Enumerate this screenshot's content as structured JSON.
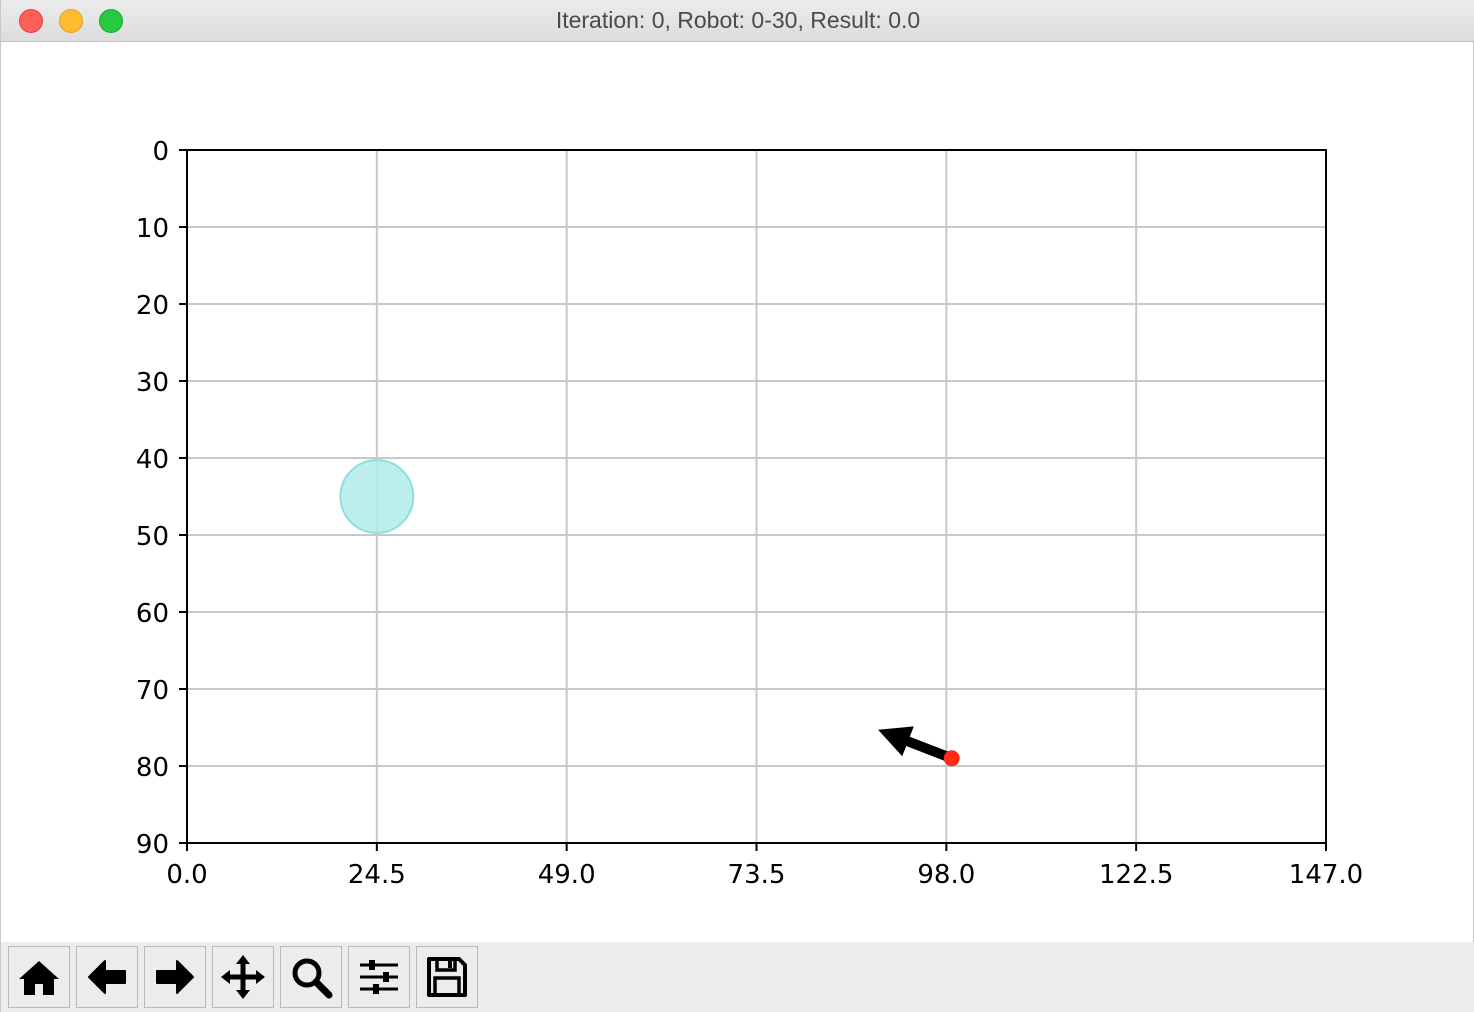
{
  "window": {
    "title": "Iteration: 0, Robot: 0-30, Result: 0.0"
  },
  "plot": {
    "x_ticks": [
      "0.0",
      "24.5",
      "49.0",
      "73.5",
      "98.0",
      "122.5",
      "147.0"
    ],
    "y_ticks": [
      "0",
      "10",
      "20",
      "30",
      "40",
      "50",
      "60",
      "70",
      "80",
      "90"
    ],
    "grid": true,
    "y_inverted": true,
    "colors": {
      "target": "#b2ebeb",
      "target_edge": "#8fdede",
      "robot": "#ff2a1a",
      "arrow": "#000000",
      "grid": "#c8c8c8"
    }
  },
  "chart_data": {
    "type": "scatter",
    "xlim": [
      0,
      147
    ],
    "ylim": [
      90,
      0
    ],
    "title": "",
    "xlabel": "",
    "ylabel": "",
    "target": {
      "x": 24.5,
      "y": 45,
      "radius": 4.7
    },
    "robot": {
      "x": 98.7,
      "y": 79
    },
    "heading": {
      "dx": -9.5,
      "dy": -3.7
    }
  },
  "toolbar": {
    "buttons": [
      "home-icon",
      "back-arrow-icon",
      "forward-arrow-icon",
      "pan-icon",
      "zoom-icon",
      "configure-subplots-icon",
      "save-icon"
    ]
  }
}
